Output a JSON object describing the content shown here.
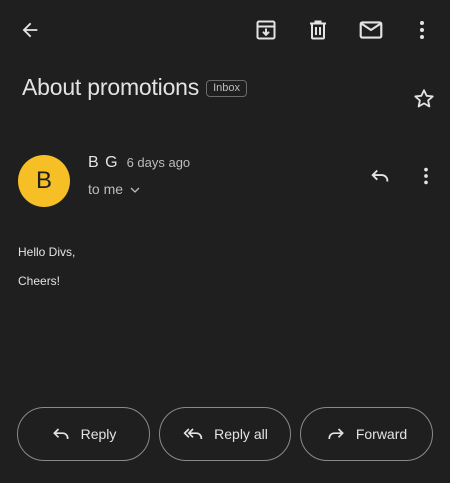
{
  "toolbar": {
    "back_icon": "arrow-back-icon",
    "archive_icon": "archive-icon",
    "delete_icon": "delete-icon",
    "mark_unread_icon": "mail-icon",
    "more_icon": "more-vert-icon"
  },
  "message": {
    "subject": "About promotions",
    "label": "Inbox",
    "star_icon": "star-outline-icon",
    "sender": {
      "avatar_letter": "B",
      "avatar_color": "#f6bf26",
      "name": "B G",
      "time": "6 days ago",
      "recipient": "to me"
    },
    "body_lines": [
      "Hello Divs,",
      "Cheers!"
    ]
  },
  "actions": {
    "reply_label": "Reply",
    "reply_all_label": "Reply all",
    "forward_label": "Forward"
  },
  "colors": {
    "background": "#1f1f1f",
    "text": "#e3e3e3",
    "secondary_text": "#bdbdbd"
  }
}
